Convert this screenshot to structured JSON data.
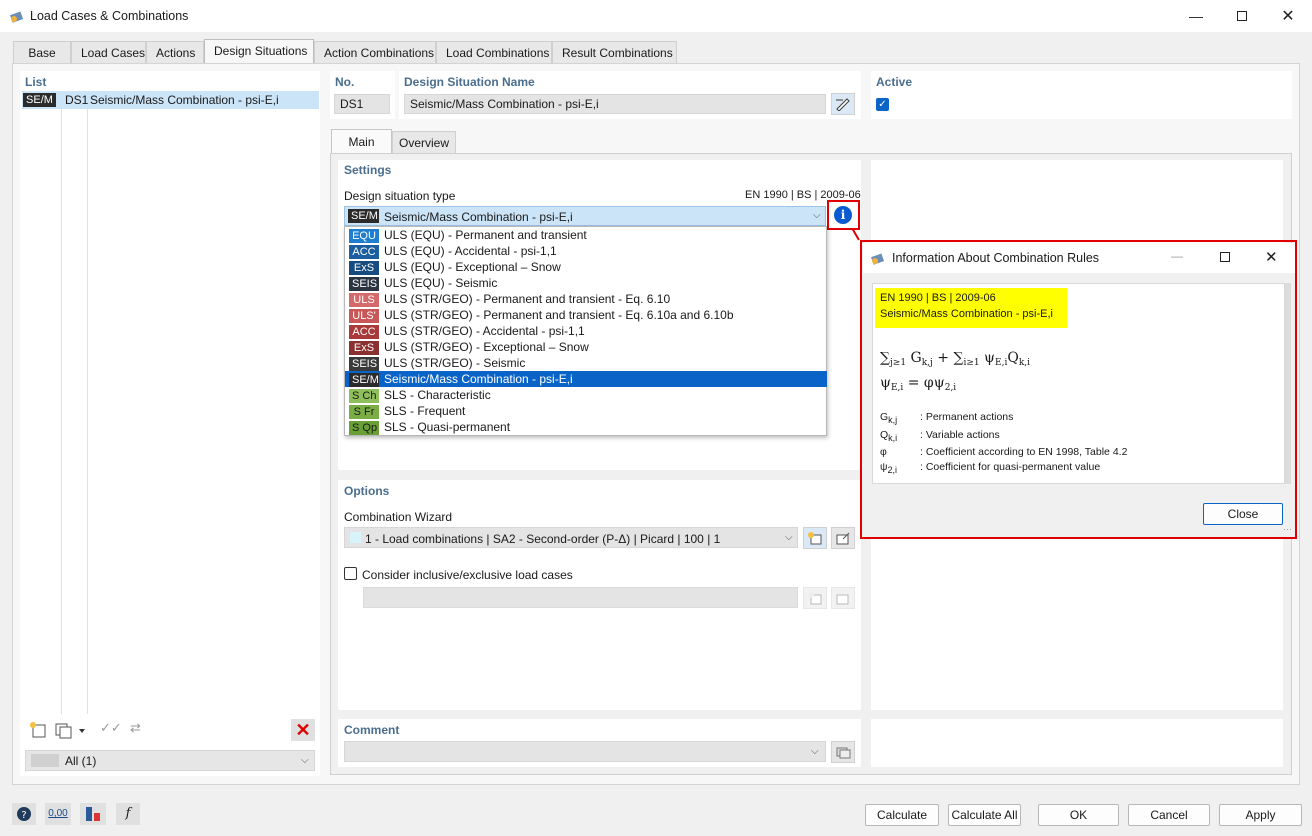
{
  "window": {
    "title": "Load Cases & Combinations"
  },
  "tabs": [
    "Base",
    "Load Cases",
    "Actions",
    "Design Situations",
    "Action Combinations",
    "Load Combinations",
    "Result Combinations"
  ],
  "list": {
    "title": "List",
    "item": {
      "badge": "SE/M",
      "id": "DS1",
      "name": "Seismic/Mass Combination - psi-E,i"
    },
    "filter": "All (1)"
  },
  "header": {
    "no_label": "No.",
    "no_value": "DS1",
    "name_label": "Design Situation Name",
    "name_value": "Seismic/Mass Combination - psi-E,i",
    "active_label": "Active",
    "active_checked": true
  },
  "subtabs": [
    "Main",
    "Overview"
  ],
  "settings": {
    "title": "Settings",
    "type_label": "Design situation type",
    "standard": "EN 1990 | BS | 2009-06",
    "selected": {
      "badge": "SE/M",
      "label": "Seismic/Mass Combination - psi-E,i",
      "color": "#2b2b2b"
    },
    "options": [
      {
        "badge": "EQU",
        "label": "ULS (EQU) - Permanent and transient",
        "color": "#1e7fd0"
      },
      {
        "badge": "ACC",
        "label": "ULS (EQU) - Accidental - psi-1,1",
        "color": "#1c5fa0"
      },
      {
        "badge": "ExS",
        "label": "ULS (EQU) - Exceptional – Snow",
        "color": "#174c80"
      },
      {
        "badge": "SEIS",
        "label": "ULS (EQU) - Seismic",
        "color": "#2b3440"
      },
      {
        "badge": "ULS",
        "label": "ULS (STR/GEO) - Permanent and transient - Eq. 6.10",
        "color": "#d46a6a"
      },
      {
        "badge": "ULS'",
        "label": "ULS (STR/GEO) - Permanent and transient - Eq. 6.10a and 6.10b",
        "color": "#c85858"
      },
      {
        "badge": "ACC",
        "label": "ULS (STR/GEO) - Accidental - psi-1,1",
        "color": "#a83a3a"
      },
      {
        "badge": "ExS",
        "label": "ULS (STR/GEO) - Exceptional – Snow",
        "color": "#8a3030"
      },
      {
        "badge": "SEIS",
        "label": "ULS (STR/GEO) - Seismic",
        "color": "#3a3a3a"
      },
      {
        "badge": "SE/M",
        "label": "Seismic/Mass Combination - psi-E,i",
        "color": "#2b2b2b",
        "selected": true
      },
      {
        "badge": "S Ch",
        "label": "SLS - Characteristic",
        "color": "#8fbf5a"
      },
      {
        "badge": "S Fr",
        "label": "SLS - Frequent",
        "color": "#7aae45"
      },
      {
        "badge": "S Qp",
        "label": "SLS - Quasi-permanent",
        "color": "#68a036"
      }
    ]
  },
  "options": {
    "title": "Options",
    "wizard_label": "Combination Wizard",
    "wizard_value": "1 - Load combinations | SA2 - Second-order (P-Δ) | Picard | 100 | 1",
    "inclusive_label": "Consider inclusive/exclusive load cases"
  },
  "comment": {
    "title": "Comment"
  },
  "dialog": {
    "title": "Information About Combination Rules",
    "highlight_line1": "EN 1990 | BS | 2009-06",
    "highlight_line2": "Seismic/Mass Combination - psi-E,i",
    "legend": [
      {
        "sym": "G",
        "sub": "k,j",
        "desc": ": Permanent actions"
      },
      {
        "sym": "Q",
        "sub": "k,i",
        "desc": ": Variable actions"
      },
      {
        "sym": "φ",
        "sub": "",
        "desc": ": Coefficient according to EN 1998, Table 4.2"
      },
      {
        "sym": "ψ",
        "sub": "2,i",
        "desc": ": Coefficient for quasi-permanent value"
      }
    ],
    "close_label": "Close"
  },
  "footer": {
    "buttons": [
      "Calculate",
      "Calculate All",
      "OK",
      "Cancel",
      "Apply"
    ],
    "icon_00": "0,00"
  },
  "colors": {
    "accent": "#0a64c8",
    "highlight": "#ffff00",
    "red_frame": "#e00000"
  }
}
